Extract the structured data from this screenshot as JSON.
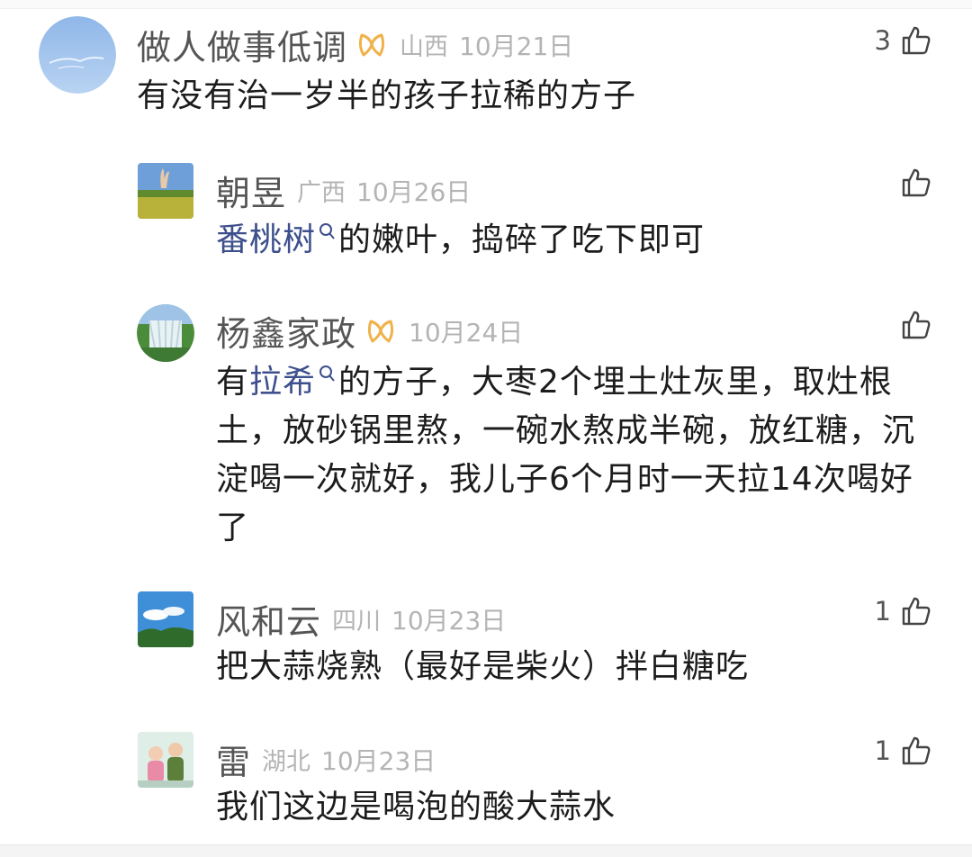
{
  "comments": [
    {
      "name": "做人做事低调",
      "region": "山西",
      "date": "10月21日",
      "likes": "3",
      "text": "有没有治一岁半的孩子拉稀的方子",
      "avatar": "sky-avatar-icon"
    }
  ],
  "replies": [
    {
      "name": "朝昱",
      "region": "广西",
      "date": "10月26日",
      "likes": "",
      "link_text": "番桃树",
      "text_after_link": "的嫩叶，捣碎了吃下即可",
      "avatar": "field-avatar-icon"
    },
    {
      "name": "杨鑫家政",
      "region": "",
      "date": "10月24日",
      "likes": "",
      "text_before_link": "有",
      "link_text": "拉希",
      "text_after_link": "的方子，大枣2个埋土灶灰里，取灶根土，放砂锅里熬，一碗水熬成半碗，放红糖，沉淀喝一次就好，我儿子6个月时一天拉14次喝好了",
      "avatar": "waterfall-avatar-icon"
    },
    {
      "name": "风和云",
      "region": "四川",
      "date": "10月23日",
      "likes": "1",
      "text": "把大蒜烧熟（最好是柴火）拌白糖吃",
      "avatar": "cloud-sky-avatar-icon"
    },
    {
      "name": "雷",
      "region": "湖北",
      "date": "10月23日",
      "likes": "1",
      "text": "我们这边是喝泡的酸大蒜水",
      "avatar": "children-photo-avatar-icon"
    }
  ],
  "colors": {
    "link": "#3d4f8c",
    "meta": "#b4b4b4",
    "badge": "#f0b24a"
  }
}
